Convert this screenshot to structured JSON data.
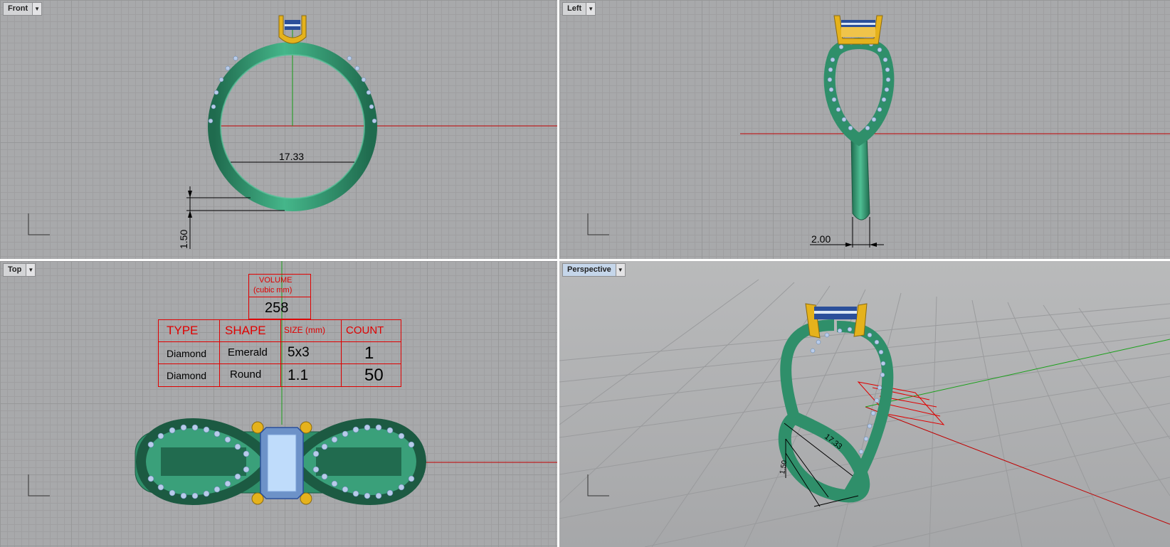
{
  "viewports": {
    "front": {
      "label": "Front"
    },
    "left": {
      "label": "Left"
    },
    "top": {
      "label": "Top"
    },
    "perspective": {
      "label": "Perspective"
    }
  },
  "dimensions": {
    "inner_diameter": "17.33",
    "band_thickness": "1.50",
    "band_width": "2.00",
    "persp_diameter": "17.33",
    "persp_thickness": "1.50"
  },
  "spec_table": {
    "volume_label": "VOLUME",
    "volume_unit": "(cubic mm)",
    "volume_value": "258",
    "headers": [
      "TYPE",
      "SHAPE",
      "SIZE (mm)",
      "COUNT"
    ],
    "rows": [
      {
        "type": "Diamond",
        "shape": "Emerald",
        "size": "5x3",
        "count": "1"
      },
      {
        "type": "Diamond",
        "shape": "Round",
        "size": "1.1",
        "count": "50"
      }
    ]
  },
  "colors": {
    "metal": "#2f8f6a",
    "prongs": "#e5b21c",
    "center_stone": "#8fb6e8",
    "accent_stones": "#b8cbea",
    "x_axis": "#c00000",
    "y_axis": "#1aa01a",
    "annotation": "#e00000"
  }
}
